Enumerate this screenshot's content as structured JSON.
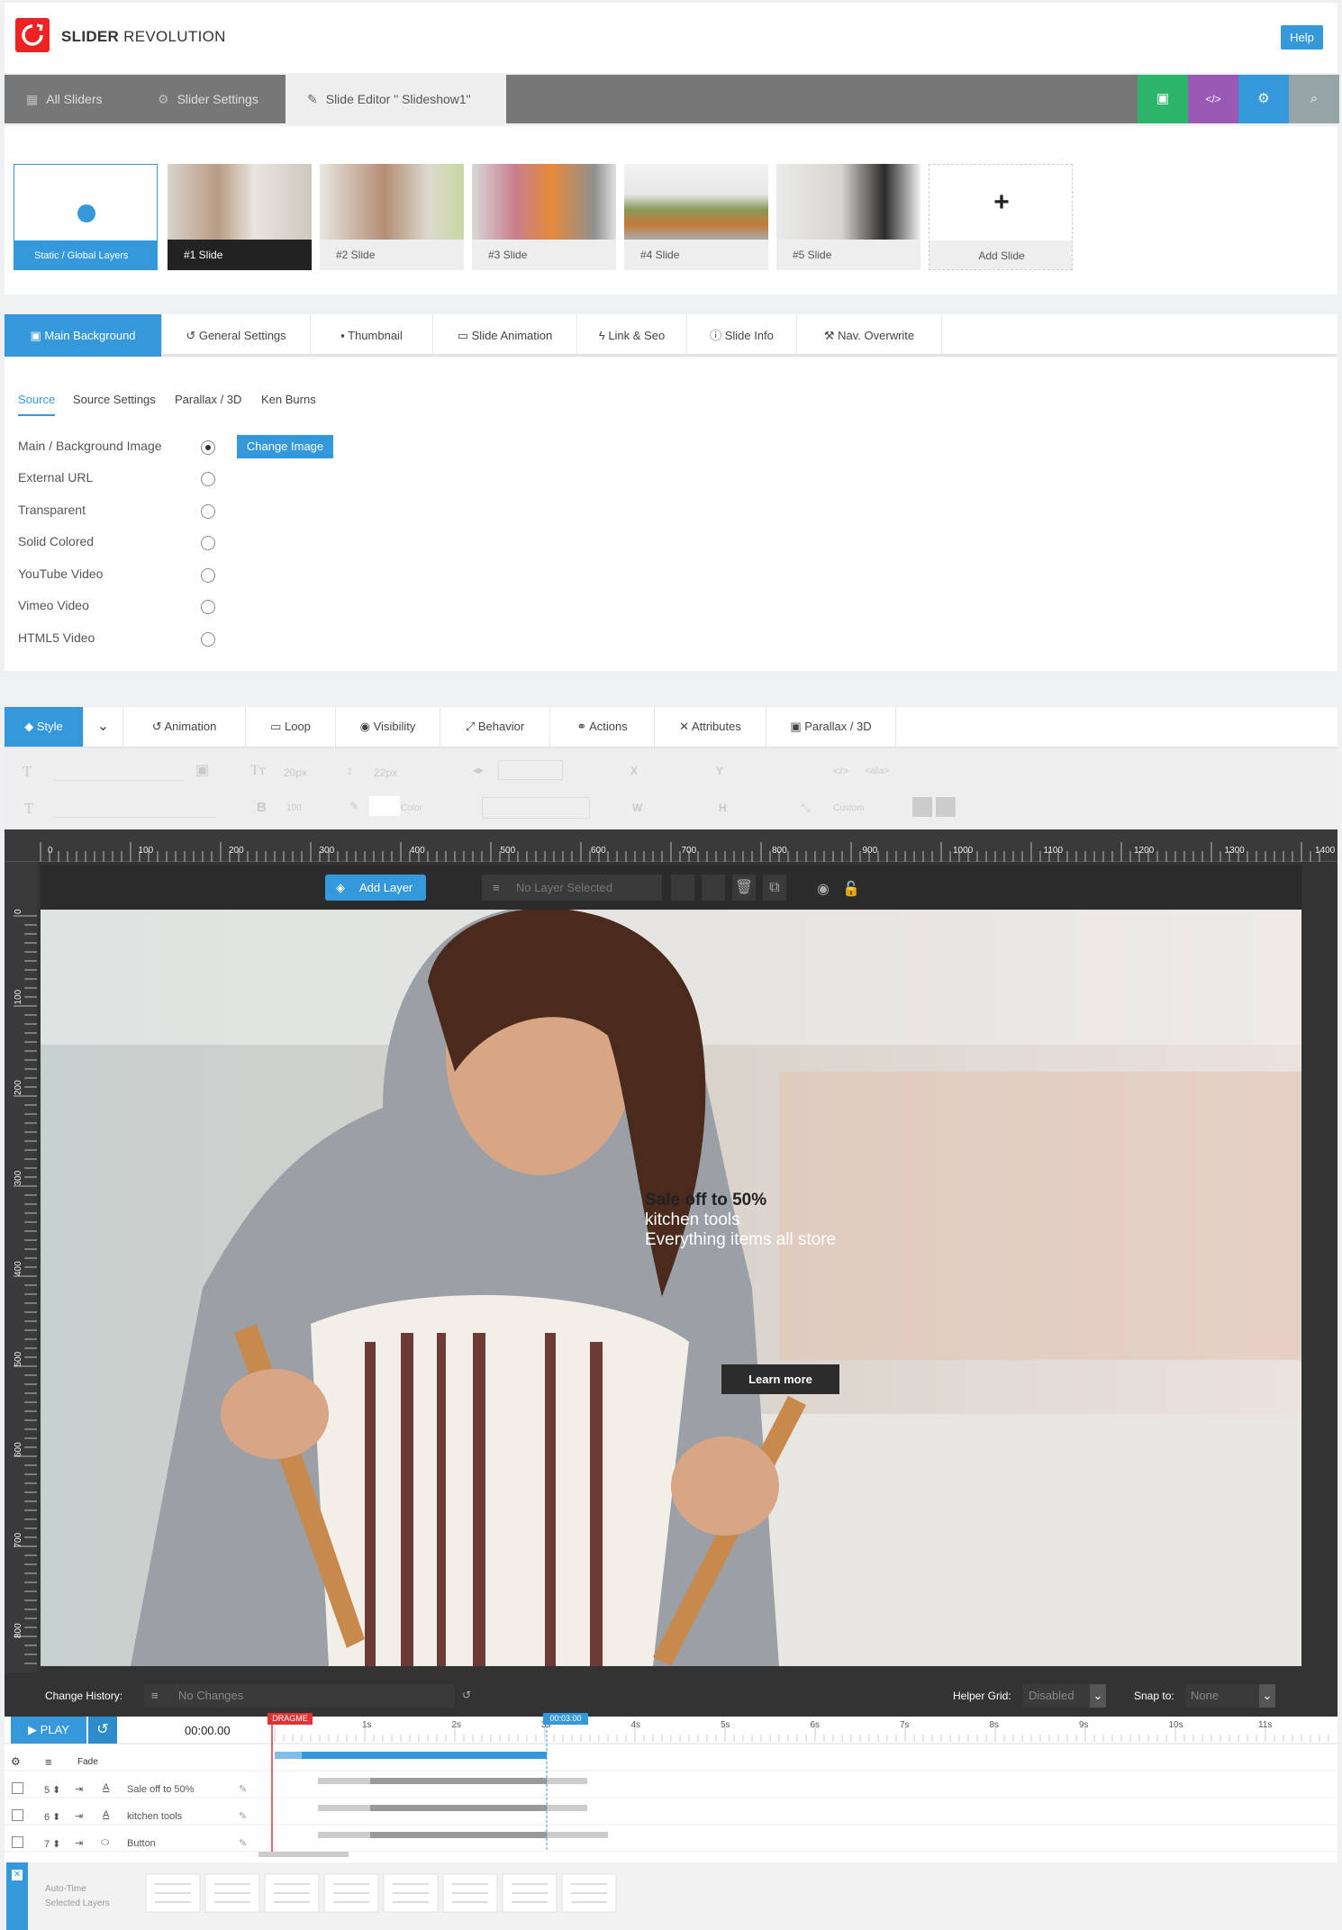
{
  "header": {
    "brand_bold": "SLIDER",
    "brand_rest": "REVOLUTION",
    "help": "Help"
  },
  "main_tabs": [
    {
      "label": "All Sliders",
      "icon": "grid-icon"
    },
    {
      "label": "Slider Settings",
      "icon": "gear-icon"
    },
    {
      "label": "Slide Editor \" Slideshow1\"",
      "icon": "pencil-icon"
    }
  ],
  "quick_buttons": [
    {
      "icon": "save-icon",
      "color": "#2ab56a"
    },
    {
      "icon": "code-icon",
      "color": "#9b59b6"
    },
    {
      "icon": "gear-icon",
      "color": "#3498db"
    },
    {
      "icon": "search-icon",
      "color": "#95a5a6"
    }
  ],
  "slides": [
    {
      "label": "Static / Global Layers"
    },
    {
      "label": "#1 Slide"
    },
    {
      "label": "#2 Slide"
    },
    {
      "label": "#3 Slide"
    },
    {
      "label": "#4 Slide"
    },
    {
      "label": "#5 Slide"
    },
    {
      "label": "Add Slide"
    }
  ],
  "settings_tabs": [
    {
      "label": "Main Background",
      "icon": "image-icon"
    },
    {
      "label": "General Settings",
      "icon": "history-icon"
    },
    {
      "label": "Thumbnail",
      "icon": "thumbnail-icon"
    },
    {
      "label": "Slide Animation",
      "icon": "animation-icon"
    },
    {
      "label": "Link & Seo",
      "icon": "bolt-icon"
    },
    {
      "label": "Slide Info",
      "icon": "info-icon"
    },
    {
      "label": "Nav. Overwrite",
      "icon": "wand-icon"
    }
  ],
  "sub_tabs": [
    "Source",
    "Source Settings",
    "Parallax / 3D",
    "Ken Burns"
  ],
  "source_options": [
    {
      "label": "Main / Background Image",
      "checked": true
    },
    {
      "label": "External URL",
      "checked": false
    },
    {
      "label": "Transparent",
      "checked": false
    },
    {
      "label": "Solid Colored",
      "checked": false
    },
    {
      "label": "YouTube Video",
      "checked": false
    },
    {
      "label": "Vimeo Video",
      "checked": false
    },
    {
      "label": "HTML5 Video",
      "checked": false
    }
  ],
  "change_image": "Change Image",
  "layer_tabs": [
    {
      "label": "Style",
      "icon": "drop-icon"
    },
    {
      "label": "Animation",
      "icon": "history-icon"
    },
    {
      "label": "Loop",
      "icon": "loop-icon"
    },
    {
      "label": "Visibility",
      "icon": "eye-icon"
    },
    {
      "label": "Behavior",
      "icon": "expand-icon"
    },
    {
      "label": "Actions",
      "icon": "link-icon"
    },
    {
      "label": "Attributes",
      "icon": "tools-icon"
    },
    {
      "label": "Parallax / 3D",
      "icon": "image-icon"
    }
  ],
  "toolbar": {
    "font_size": "20px",
    "line_height": "22px",
    "x": "X",
    "y": "Y",
    "alias": "<alia>",
    "weight": "100",
    "color": "Color",
    "w": "W",
    "h": "H",
    "custom": "Custom"
  },
  "ruler_h": [
    "0",
    "100",
    "200",
    "300",
    "400",
    "500",
    "600",
    "700",
    "800",
    "900",
    "1000",
    "1100",
    "1200",
    "1300",
    "1400"
  ],
  "ruler_v": [
    "0",
    "100",
    "200",
    "300",
    "400",
    "500",
    "600",
    "700",
    "800"
  ],
  "stage": {
    "add_layer": "Add Layer",
    "no_layer": "No Layer Selected"
  },
  "canvas_layers": {
    "line1": "Sale off to 50%",
    "line2": "kitchen tools",
    "line3": "Everything items all store",
    "button": "Learn more"
  },
  "history": {
    "label": "Change History:",
    "value": "No Changes",
    "helper_label": "Helper Grid:",
    "helper_value": "Disabled",
    "snap_label": "Snap to:",
    "snap_value": "None"
  },
  "timeline": {
    "play": "PLAY",
    "time": "00:00.00",
    "dragme": "DRAGME",
    "marker": "00:03.00",
    "ticks": [
      "1s",
      "2s",
      "3s",
      "4s",
      "5s",
      "6s",
      "7s",
      "8s",
      "9s",
      "10s",
      "11s"
    ],
    "fade": "Fade",
    "rows": [
      {
        "num": "5",
        "label": "Sale off to 50%"
      },
      {
        "num": "6",
        "label": "kitchen tools"
      },
      {
        "num": "7",
        "label": "Button"
      }
    ],
    "autotime_1": "Auto-Time",
    "autotime_2": "Selected Layers"
  }
}
